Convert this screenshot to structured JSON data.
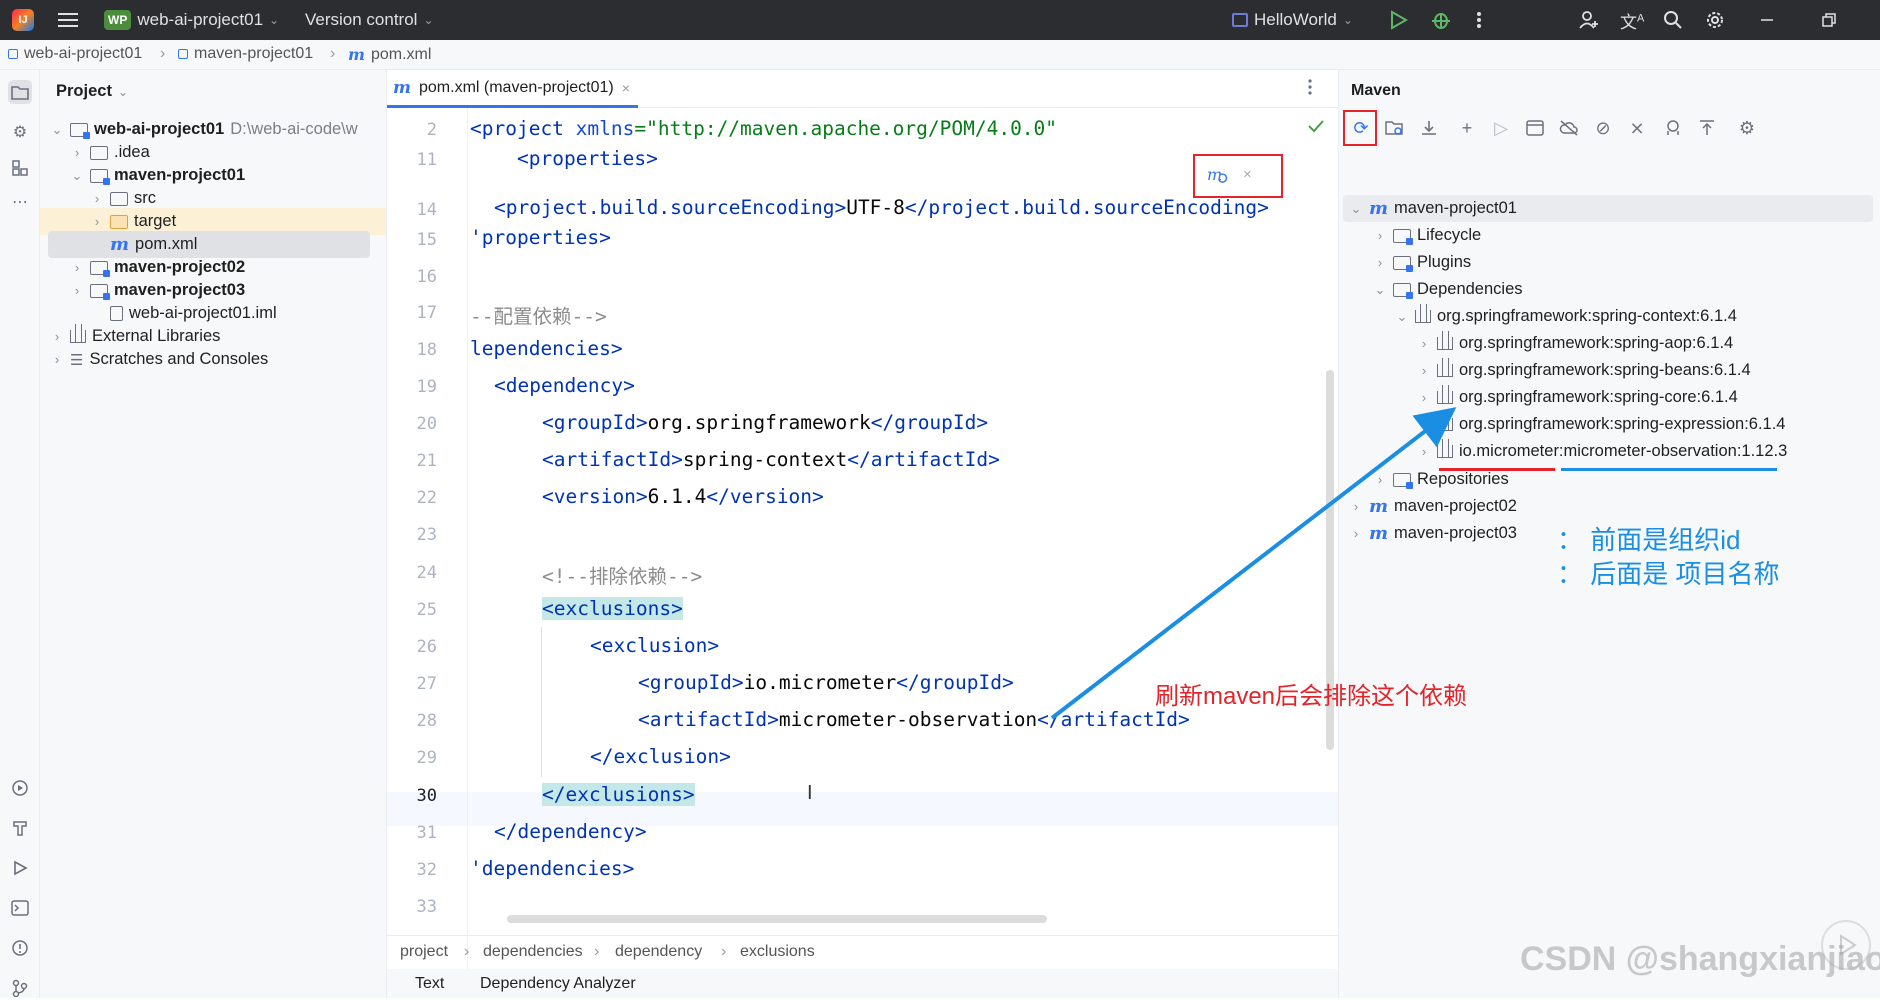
{
  "titlebar": {
    "project_badge": "WP",
    "project_name": "web-ai-project01",
    "vcs_label": "Version control",
    "run_config": "HelloWorld"
  },
  "breadcrumb": [
    "web-ai-project01",
    "maven-project01",
    "pom.xml"
  ],
  "project_panel": {
    "title": "Project",
    "tree": [
      {
        "label": "web-ai-project01",
        "path": "D:\\web-ai-code\\w",
        "bold": true
      },
      {
        "label": ".idea"
      },
      {
        "label": "maven-project01",
        "bold": true
      },
      {
        "label": "src"
      },
      {
        "label": "target"
      },
      {
        "label": "pom.xml"
      },
      {
        "label": "maven-project02",
        "bold": true
      },
      {
        "label": "maven-project03",
        "bold": true
      },
      {
        "label": "web-ai-project01.iml"
      },
      {
        "label": "External Libraries"
      },
      {
        "label": "Scratches and Consoles"
      }
    ]
  },
  "editor": {
    "tab_label": "pom.xml (maven-project01)",
    "lines": [
      {
        "no": "2"
      },
      {
        "no": "11"
      },
      {
        "no": "14"
      },
      {
        "no": "15"
      },
      {
        "no": "16"
      },
      {
        "no": "17"
      },
      {
        "no": "18"
      },
      {
        "no": "19"
      },
      {
        "no": "20"
      },
      {
        "no": "21"
      },
      {
        "no": "22"
      },
      {
        "no": "23"
      },
      {
        "no": "24"
      },
      {
        "no": "25"
      },
      {
        "no": "26"
      },
      {
        "no": "27"
      },
      {
        "no": "28"
      },
      {
        "no": "29"
      },
      {
        "no": "30"
      },
      {
        "no": "31"
      },
      {
        "no": "32"
      },
      {
        "no": "33"
      }
    ],
    "code": {
      "l2_tag": "<project ",
      "l2_attr": "xmlns",
      "l2_eq": "=",
      "l2_str": "\"http://maven.apache.org/POM/4.0.0\"",
      "l11": "<properties>",
      "l14_open": "<project.build.sourceEncoding>",
      "l14_val": "UTF-8",
      "l14_close": "</project.build.sourceEncoding>",
      "l15": "'properties>",
      "l17": "--配置依赖-->",
      "l18": "lependencies>",
      "l19": "<dependency>",
      "l20_open": "<groupId>",
      "l20_val": "org.springframework",
      "l20_close": "</groupId>",
      "l21_open": "<artifactId>",
      "l21_val": "spring-context",
      "l21_close": "</artifactId>",
      "l22_open": "<version>",
      "l22_val": "6.1.4",
      "l22_close": "</version>",
      "l24": "<!--排除依赖-->",
      "l25": "<exclusions>",
      "l26": "<exclusion>",
      "l27_open": "<groupId>",
      "l27_val": "io.micrometer",
      "l27_close": "</groupId>",
      "l28_open": "<artifactId>",
      "l28_val": "micrometer-observation",
      "l28_close": "</artifactId>",
      "l29": "</exclusion>",
      "l30": "</exclusions>",
      "l31": "</dependency>",
      "l32": "'dependencies>"
    },
    "breadcrumbs": [
      "project",
      "dependencies",
      "dependency",
      "exclusions"
    ],
    "bottom_tabs": [
      "Text",
      "Dependency Analyzer"
    ]
  },
  "maven_panel": {
    "title": "Maven",
    "tree": [
      {
        "label": "maven-project01"
      },
      {
        "label": "Lifecycle"
      },
      {
        "label": "Plugins"
      },
      {
        "label": "Dependencies"
      },
      {
        "label": "org.springframework:spring-context:6.1.4"
      },
      {
        "label": "org.springframework:spring-aop:6.1.4"
      },
      {
        "label": "org.springframework:spring-beans:6.1.4"
      },
      {
        "label": "org.springframework:spring-core:6.1.4"
      },
      {
        "label": "org.springframework:spring-expression:6.1.4"
      },
      {
        "label": "io.micrometer:micrometer-observation:1.12.3"
      },
      {
        "label": "Repositories"
      },
      {
        "label": "maven-project02"
      },
      {
        "label": "maven-project03"
      }
    ]
  },
  "annotations": {
    "org_note": "： 前面是组织id",
    "name_note": "： 后面是 项目名称",
    "refresh_note": "刷新maven后会排除这个依赖"
  },
  "watermark": "CSDN @shangxianjiao",
  "colors": {
    "accent": "#3574f0",
    "annotation_red": "#e3242b",
    "annotation_blue": "#1a8ee3",
    "titlebar_bg": "#2b2d30"
  }
}
